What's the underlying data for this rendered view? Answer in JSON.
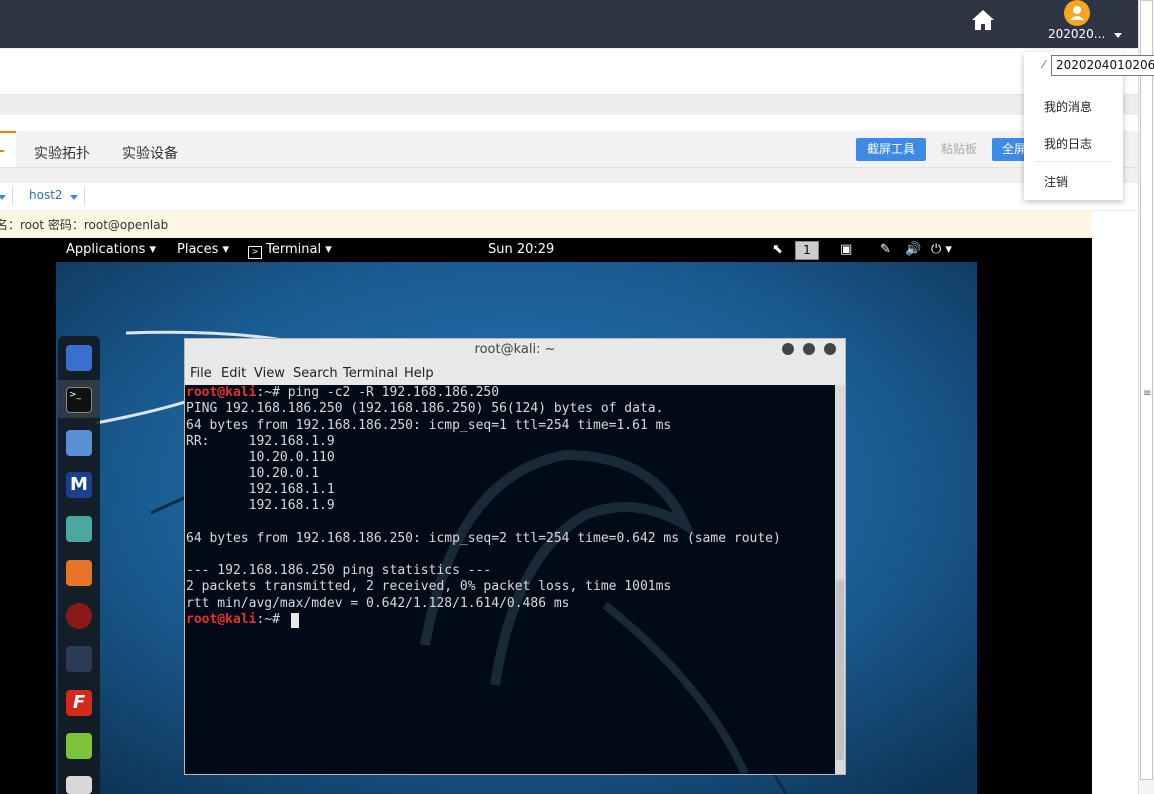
{
  "header": {
    "username": "202020...",
    "user_tooltip": "2020204010206"
  },
  "user_menu": [
    "我的消息",
    "我的日志",
    "注销"
  ],
  "tabs": [
    "实验拓扑",
    "实验设备"
  ],
  "toolbar": {
    "screenshot": "截屏工具",
    "clipboard": "粘贴板",
    "fullscreen": "全屏"
  },
  "hosts": {
    "host2": "host2"
  },
  "credentials": "名：root  密码：root@openlab",
  "vm_panel": {
    "applications": "Applications",
    "places": "Places",
    "terminal": "Terminal",
    "clock": "Sun 20:29",
    "workspace": "1"
  },
  "terminal_window": {
    "title": "root@kali: ~",
    "menu": [
      "File",
      "Edit",
      "View",
      "Search",
      "Terminal",
      "Help"
    ]
  },
  "terminal": {
    "prompt_user": "root@kali",
    "prompt_suffix": ":~# ",
    "command": "ping -c2 -R 192.168.186.250",
    "out1": "PING 192.168.186.250 (192.168.186.250) 56(124) bytes of data.",
    "out2": "64 bytes from 192.168.186.250: icmp_seq=1 ttl=254 time=1.61 ms",
    "rr1": "RR:     192.168.1.9",
    "rr2": "        10.20.0.110",
    "rr3": "        10.20.0.1",
    "rr4": "        192.168.1.1",
    "rr5": "        192.168.1.9",
    "out3": "64 bytes from 192.168.186.250: icmp_seq=2 ttl=254 time=0.642 ms (same route)",
    "stat1": "--- 192.168.186.250 ping statistics ---",
    "stat2": "2 packets transmitted, 2 received, 0% packet loss, time 1001ms",
    "stat3": "rtt min/avg/max/mdev = 0.642/1.128/1.614/0.486 ms",
    "prompt2_suffix": ":~# "
  }
}
